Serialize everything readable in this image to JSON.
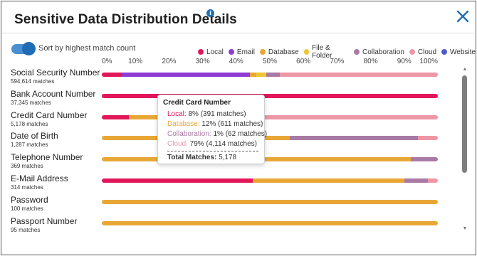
{
  "modal": {
    "title": "Sensitive Data Distribution Details",
    "info_icon": "info-icon",
    "close_icon": "close-icon"
  },
  "toolbar": {
    "sort_toggle_label": "Sort by highest match count",
    "sort_toggle_on": true
  },
  "legend": [
    {
      "label": "Local",
      "color": "#e2175a"
    },
    {
      "label": "Email",
      "color": "#8e3bd3"
    },
    {
      "label": "Database",
      "color": "#e8a735"
    },
    {
      "label": "File & Folder",
      "color": "#f0c534"
    },
    {
      "label": "Collaboration",
      "color": "#a97aa5"
    },
    {
      "label": "Cloud",
      "color": "#ed97a5"
    },
    {
      "label": "Website",
      "color": "#4c5ec4"
    }
  ],
  "chart_data": {
    "type": "bar",
    "orientation": "horizontal",
    "stacked": "percent",
    "x_ticks": [
      "0%",
      "10%",
      "20%",
      "30%",
      "40%",
      "50%",
      "60%",
      "70%",
      "80%",
      "90%",
      "100%"
    ],
    "xlim": [
      0,
      100
    ],
    "categories": [
      "Social Security Number",
      "Bank Account Number",
      "Credit Card Number",
      "Date of Birth",
      "Telephone Number",
      "E-Mail Address",
      "Password",
      "Passport Number"
    ],
    "match_counts": [
      "594,614 matches",
      "37,345 matches",
      "5,178 matches",
      "1,287 matches",
      "369 matches",
      "314 matches",
      "100 matches",
      "95 matches"
    ],
    "series": [
      {
        "name": "Local",
        "color": "#e2175a",
        "values": [
          6,
          100,
          8,
          0,
          0,
          45,
          0,
          0
        ]
      },
      {
        "name": "Email",
        "color": "#8e3bd3",
        "values": [
          38,
          0,
          0,
          0,
          0,
          0,
          0,
          0
        ]
      },
      {
        "name": "Database",
        "color": "#e8a735",
        "values": [
          2,
          0,
          12,
          56,
          92,
          45,
          100,
          100
        ]
      },
      {
        "name": "File & Folder",
        "color": "#f0c534",
        "values": [
          3,
          0,
          0,
          0,
          0,
          0,
          0,
          0
        ]
      },
      {
        "name": "Collaboration",
        "color": "#a97aa5",
        "values": [
          4,
          0,
          1,
          38,
          8,
          7,
          0,
          0
        ]
      },
      {
        "name": "Cloud",
        "color": "#ed97a5",
        "values": [
          47,
          0,
          79,
          6,
          0,
          3,
          0,
          0
        ]
      },
      {
        "name": "Website",
        "color": "#4c5ec4",
        "values": [
          0,
          0,
          0,
          0,
          0,
          0,
          0,
          0
        ]
      }
    ]
  },
  "tooltip": {
    "title": "Credit Card Number",
    "lines": [
      {
        "name": "Local:",
        "value": "8% (391 matches)",
        "color": "#e2175a"
      },
      {
        "name": "Database:",
        "value": "12% (611 matches)",
        "color": "#e8a735"
      },
      {
        "name": "Collaboration:",
        "value": "1% (62 matches)",
        "color": "#a97aa5"
      },
      {
        "name": "Cloud:",
        "value": "79% (4,114 matches)",
        "color": "#ed97a5"
      }
    ],
    "total_label": "Total Matches:",
    "total_value": "5,178"
  }
}
